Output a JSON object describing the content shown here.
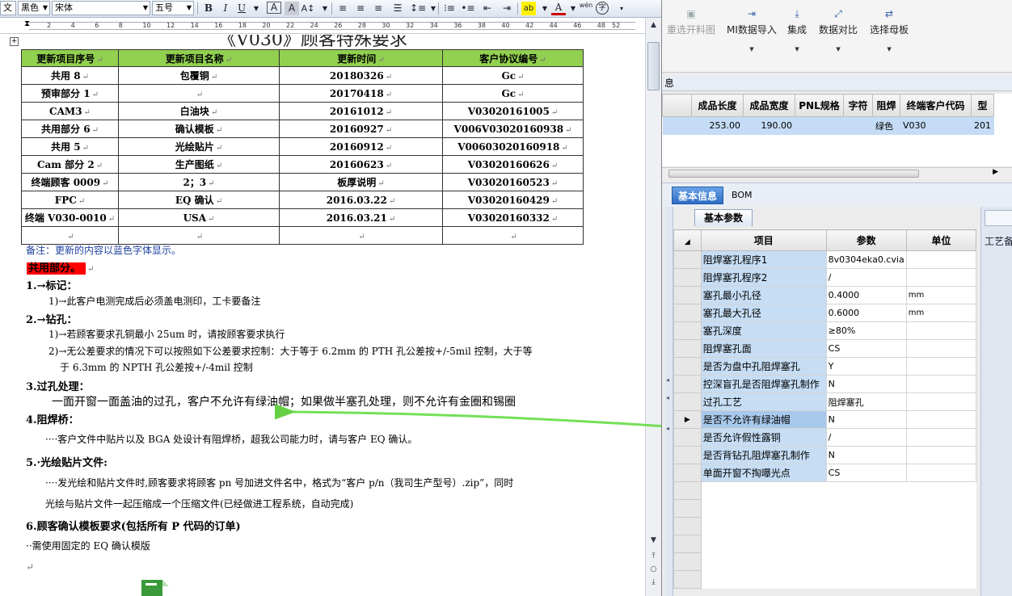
{
  "word": {
    "toolbar": {
      "style_value": "文 +",
      "color_value": "黑色",
      "font_value": "宋体",
      "size_value": "五号",
      "bold": "B",
      "italic": "I",
      "underline": "U",
      "char_a": "A",
      "char_a2": "A",
      "font_color": "A",
      "pinyin": "wén"
    },
    "ruler_numbers": [
      "2",
      "4",
      "6",
      "8",
      "10",
      "12",
      "14",
      "16",
      "18",
      "20",
      "22",
      "24",
      "26",
      "28",
      "30",
      "32",
      "34",
      "36",
      "38",
      "40",
      "42",
      "44",
      "46",
      "48",
      "52"
    ],
    "title_partial": "《V030》顾客特殊要求",
    "table": {
      "headers": [
        "更新项目序号",
        "更新项目名称",
        "更新时间",
        "客户协议编号"
      ],
      "rows": [
        [
          "共用 8",
          "包覆铜",
          "20180326",
          "Gc"
        ],
        [
          "预审部分 1",
          "",
          "20170418",
          "Gc"
        ],
        [
          "CAM3",
          "白油块",
          "20161012",
          "V03020161005"
        ],
        [
          "共用部分 6",
          "确认模板",
          "20160927",
          "V006V03020160938"
        ],
        [
          "共用 5",
          "光绘贴片",
          "20160912",
          "V00603020160918"
        ],
        [
          "Cam 部分 2",
          "生产图纸",
          "20160623",
          "V03020160626"
        ],
        [
          "终端顾客 0009",
          "2；3",
          "板厚说明",
          "V03020160523"
        ],
        [
          "FPC",
          "EQ 确认",
          "2016.03.22",
          "V03020160429"
        ],
        [
          "终端 V030-0010",
          "USA",
          "2016.03.21",
          "V03020160332"
        ],
        [
          "",
          "",
          "",
          ""
        ]
      ]
    },
    "note": "备注：更新的内容以蓝色字体显示。",
    "section_common": "共用部分。",
    "h1": "1.→标记：",
    "h1_1": "1)→此客户电测完成后必须盖电测印，工卡要备注",
    "h2": "2.→钻孔：",
    "h2_1": "1)→若顾客要求孔铜最小 25um 时，请按顾客要求执行",
    "h2_2a": "2)→无公差要求的情况下可以按照如下公差要求控制：大于等于 6.2mm 的 PTH 孔公差按+/-5mil 控制，大于等",
    "h2_2b": "于 6.3mm 的 NPTH 孔公差按+/-4mil 控制",
    "h3": "3.过孔处理：",
    "h3_1": "一面开窗一面盖油的过孔，客户不允许有绿油帽；如果做半塞孔处理，则不允许有金圈和锡圈",
    "h4": "4.阻焊桥：",
    "h4_1": "····客户文件中贴片以及 BGA 处设计有阻焊桥，超我公司能力时，请与客户 EQ 确认。",
    "h5": "5.·光绘贴片文件:",
    "h5_1": "····发光绘和贴片文件时,顾客要求将顾客 pn 号加进文件名中，格式为“客户 p/n（我司生产型号）.zip”，同时",
    "h5_2": "光绘与贴片文件一起压缩成一个压缩文件(已经做进工程系统，自动完成)",
    "h6": "6.顾客确认模板要求(包括所有 P 代码的订单)",
    "h6_1": "··需使用固定的 EQ 确认模版"
  },
  "erp": {
    "toolbar": [
      {
        "label": "重选开料图",
        "icon": "image-icon",
        "enabled": false
      },
      {
        "label": "MI数据导入",
        "icon": "import-icon",
        "enabled": true
      },
      {
        "label": "集成",
        "icon": "download-icon",
        "enabled": true
      },
      {
        "label": "数据对比",
        "icon": "compare-icon",
        "enabled": true
      },
      {
        "label": "选择母板",
        "icon": "shuffle-icon",
        "enabled": true
      }
    ],
    "info_label": "息",
    "grid1": {
      "headers": [
        "成品长度",
        "成品宽度",
        "PNL规格",
        "字符",
        "阻焊",
        "终端客户代码",
        "型"
      ],
      "row": [
        "253.00",
        "190.00",
        "",
        "",
        "绿色",
        "V030",
        "201"
      ]
    },
    "tabs": [
      "基本信息",
      "BOM"
    ],
    "subtab": "基本参数",
    "right_label": "工艺备",
    "grid2": {
      "headers": [
        "项目",
        "参数",
        "单位"
      ],
      "rows": [
        {
          "item": "阻焊塞孔程序1",
          "param": "8v0304eka0.cvia",
          "unit": ""
        },
        {
          "item": "阻焊塞孔程序2",
          "param": "/",
          "unit": ""
        },
        {
          "item": "塞孔最小孔径",
          "param": "0.4000",
          "unit": "mm"
        },
        {
          "item": "塞孔最大孔径",
          "param": "0.6000",
          "unit": "mm"
        },
        {
          "item": "塞孔深度",
          "param": "≥80%",
          "unit": ""
        },
        {
          "item": "阻焊塞孔面",
          "param": "CS",
          "unit": ""
        },
        {
          "item": "是否为盘中孔阻焊塞孔",
          "param": "Y",
          "unit": ""
        },
        {
          "item": "控深盲孔是否阻焊塞孔制作",
          "param": "N",
          "unit": ""
        },
        {
          "item": "过孔工艺",
          "param": "阻焊塞孔",
          "unit": ""
        },
        {
          "item": "是否不允许有绿油帽",
          "param": "N",
          "unit": ""
        },
        {
          "item": "是否允许假性露铜",
          "param": "/",
          "unit": ""
        },
        {
          "item": "是否背钻孔阻焊塞孔制作",
          "param": "N",
          "unit": ""
        },
        {
          "item": "单面开窗不掏曝光点",
          "param": "CS",
          "unit": ""
        }
      ]
    }
  },
  "colors": {
    "table_header": "#92d050",
    "note_blue": "#1f3f9f",
    "red_heading": "#ff0000",
    "arrow_green": "#66dd44",
    "grid_selection": "#c4dcf5",
    "tab_active": "#2d6cc4"
  }
}
